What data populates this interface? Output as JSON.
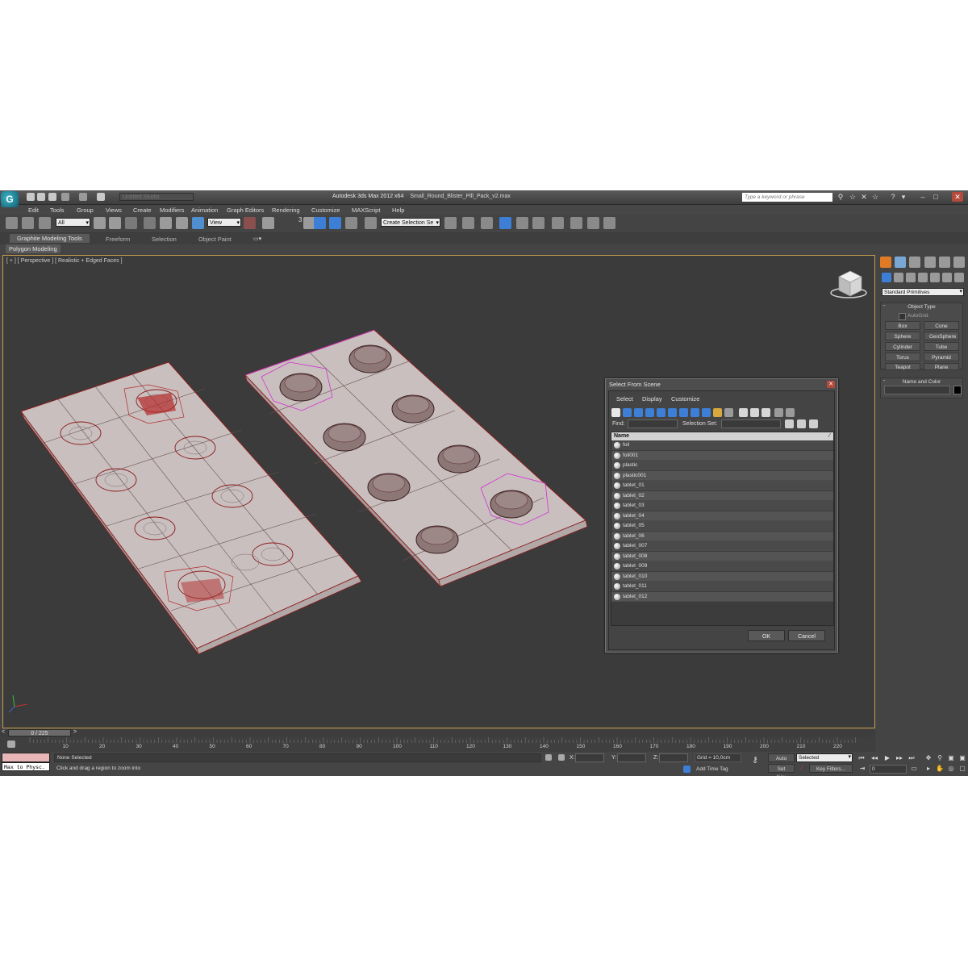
{
  "titlebar": {
    "project_placeholder": "Untitled Studio",
    "app_title": "Autodesk 3ds Max  2012 x64",
    "file_name": "Small_Round_Blister_Pill_Pack_v2.max",
    "search_placeholder": "Type a keyword or phrase"
  },
  "menubar": [
    "Edit",
    "Tools",
    "Group",
    "Views",
    "Create",
    "Modifiers",
    "Animation",
    "Graph Editors",
    "Rendering",
    "Customize",
    "MAXScript",
    "Help"
  ],
  "toolbar": {
    "filter_dropdown": "All",
    "reference_coord": "View",
    "snap_count": "3",
    "selection_set": "Create Selection Se"
  },
  "ribbon": {
    "tabs": [
      "Graphite Modeling Tools",
      "Freeform",
      "Selection",
      "Object Paint"
    ],
    "active_tab": "Graphite Modeling Tools",
    "sub_panel": "Polygon Modeling"
  },
  "viewport": {
    "label": "[ + ] [ Perspective ] [ Realistic + Edged Faces ]"
  },
  "dialog": {
    "title": "Select From Scene",
    "menu": [
      "Select",
      "Display",
      "Customize"
    ],
    "find_label": "Find:",
    "selection_set_label": "Selection Set:",
    "column_name": "Name",
    "items": [
      "foil",
      "foil001",
      "plastic",
      "plastic001",
      "tablet_01",
      "tablet_02",
      "tablet_03",
      "tablet_04",
      "tablet_05",
      "tablet_06",
      "tablet_007",
      "tablet_008",
      "tablet_009",
      "tablet_010",
      "tablet_011",
      "tablet_012"
    ],
    "ok_label": "OK",
    "cancel_label": "Cancel"
  },
  "command_panel": {
    "category_dropdown": "Standard Primitives",
    "object_type_title": "Object Type",
    "autogrid_label": "AutoGrid",
    "primitives": [
      "Box",
      "Cone",
      "Sphere",
      "GeoSphere",
      "Cylinder",
      "Tube",
      "Torus",
      "Pyramid",
      "Teapot",
      "Plane"
    ],
    "name_color_title": "Name and Color"
  },
  "timeline": {
    "frame_readout": "0 / 225",
    "ticks": [
      "10",
      "20",
      "30",
      "40",
      "50",
      "60",
      "70",
      "80",
      "90",
      "100",
      "110",
      "120",
      "130",
      "140",
      "150",
      "160",
      "170",
      "180",
      "190",
      "200",
      "210",
      "220"
    ]
  },
  "statusbar": {
    "script_output": "Max to Physc.",
    "selection_status": "None Selected",
    "prompt": "Click and drag a region to zoom into",
    "x_label": "X:",
    "y_label": "Y:",
    "z_label": "Z:",
    "grid": "Grid = 10,0cm",
    "add_time_tag": "Add Time Tag",
    "auto_key": "Auto Key",
    "set_key": "Set Key",
    "key_mode": "Selected",
    "key_filters": "Key Filters...",
    "current_frame": "0"
  },
  "colors": {
    "viewport_border": "#c8a04c",
    "viewport_bg": "#3b3b3b",
    "mesh_fill": "#c7bdbd",
    "wire_red": "#8c1b1b",
    "wire_magenta": "#d431d4",
    "active_tool": "#3d7fd6"
  }
}
